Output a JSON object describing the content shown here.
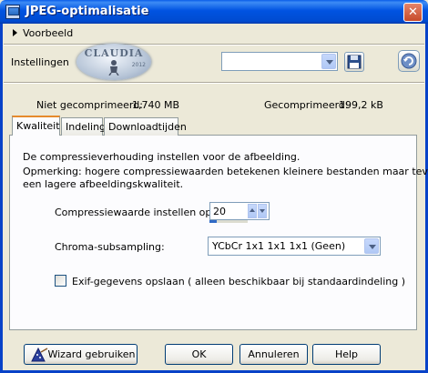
{
  "window": {
    "title": "JPEG-optimalisatie",
    "close_glyph": "✕"
  },
  "preview": {
    "label": "Voorbeeld"
  },
  "settings": {
    "label": "Instellingen",
    "preset_value": "",
    "watermark_text": "CLAUDIA",
    "watermark_year": "2012"
  },
  "sizes": {
    "uncompressed_label": "Niet gecomprimeerd:",
    "uncompressed_value": "1,740 MB",
    "compressed_label": "Gecomprimeerd:",
    "compressed_value": "199,2 kB"
  },
  "tabs": [
    {
      "label": "Kwaliteit",
      "active": true
    },
    {
      "label": "Indeling",
      "active": false
    },
    {
      "label": "Downloadtijden",
      "active": false
    }
  ],
  "quality": {
    "description": "De compressieverhouding instellen voor de afbeelding.",
    "note_line1": "Opmerking:  hogere compressiewaarden betekenen kleinere bestanden maar tevens",
    "note_line2": "een lagere afbeeldingskwaliteit.",
    "compression_label": "Compressiewaarde instellen op:",
    "compression_value": "20",
    "compression_fraction": 0.2,
    "chroma_label": "Chroma-subsampling:",
    "chroma_value": "YCbCr  1x1  1x1  1x1  (Geen)",
    "exif_label": "Exif-gegevens opslaan ( alleen beschikbaar bij standaardindeling )",
    "exif_checked": false
  },
  "buttons": {
    "wizard": "Wizard gebruiken",
    "ok": "OK",
    "cancel": "Annuleren",
    "help": "Help"
  },
  "colors": {
    "titlebar": "#0054e3",
    "dialog_bg": "#ece9d8",
    "tab_active_accent": "#e68b2c"
  }
}
